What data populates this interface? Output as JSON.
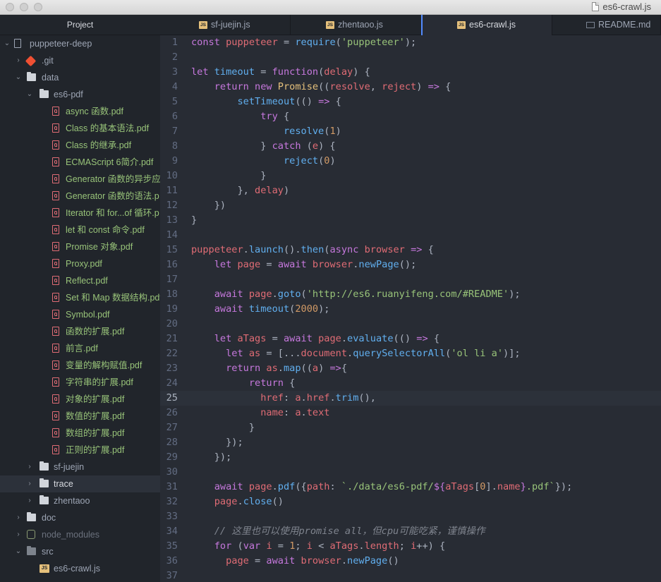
{
  "window": {
    "title": "es6-crawl.js"
  },
  "sidebar": {
    "header": "Project",
    "rows": [
      {
        "label": "puppeteer-deep",
        "depth": 0,
        "chev": "⌄",
        "icon": "repo",
        "kind": "dir"
      },
      {
        "label": ".git",
        "depth": 1,
        "chev": "›",
        "icon": "git",
        "kind": "dir"
      },
      {
        "label": "data",
        "depth": 1,
        "chev": "⌄",
        "icon": "folder",
        "kind": "dir"
      },
      {
        "label": "es6-pdf",
        "depth": 2,
        "chev": "⌄",
        "icon": "folder",
        "kind": "dir"
      },
      {
        "label": "async 函数.pdf",
        "depth": 3,
        "icon": "pdf",
        "kind": "pdf"
      },
      {
        "label": "Class 的基本语法.pdf",
        "depth": 3,
        "icon": "pdf",
        "kind": "pdf"
      },
      {
        "label": "Class 的继承.pdf",
        "depth": 3,
        "icon": "pdf",
        "kind": "pdf"
      },
      {
        "label": "ECMAScript 6简介.pdf",
        "depth": 3,
        "icon": "pdf",
        "kind": "pdf"
      },
      {
        "label": "Generator 函数的异步应",
        "depth": 3,
        "icon": "pdf",
        "kind": "pdf"
      },
      {
        "label": "Generator 函数的语法.p",
        "depth": 3,
        "icon": "pdf",
        "kind": "pdf"
      },
      {
        "label": "Iterator 和 for...of 循环.p",
        "depth": 3,
        "icon": "pdf",
        "kind": "pdf"
      },
      {
        "label": "let 和 const 命令.pdf",
        "depth": 3,
        "icon": "pdf",
        "kind": "pdf"
      },
      {
        "label": "Promise 对象.pdf",
        "depth": 3,
        "icon": "pdf",
        "kind": "pdf"
      },
      {
        "label": "Proxy.pdf",
        "depth": 3,
        "icon": "pdf",
        "kind": "pdf"
      },
      {
        "label": "Reflect.pdf",
        "depth": 3,
        "icon": "pdf",
        "kind": "pdf"
      },
      {
        "label": "Set 和 Map 数据结构.pdf",
        "depth": 3,
        "icon": "pdf",
        "kind": "pdf"
      },
      {
        "label": "Symbol.pdf",
        "depth": 3,
        "icon": "pdf",
        "kind": "pdf"
      },
      {
        "label": "函数的扩展.pdf",
        "depth": 3,
        "icon": "pdf",
        "kind": "pdf"
      },
      {
        "label": "前言.pdf",
        "depth": 3,
        "icon": "pdf",
        "kind": "pdf"
      },
      {
        "label": "变量的解构赋值.pdf",
        "depth": 3,
        "icon": "pdf",
        "kind": "pdf"
      },
      {
        "label": "字符串的扩展.pdf",
        "depth": 3,
        "icon": "pdf",
        "kind": "pdf"
      },
      {
        "label": "对象的扩展.pdf",
        "depth": 3,
        "icon": "pdf",
        "kind": "pdf"
      },
      {
        "label": "数值的扩展.pdf",
        "depth": 3,
        "icon": "pdf",
        "kind": "pdf"
      },
      {
        "label": "数组的扩展.pdf",
        "depth": 3,
        "icon": "pdf",
        "kind": "pdf"
      },
      {
        "label": "正则的扩展.pdf",
        "depth": 3,
        "icon": "pdf",
        "kind": "pdf"
      },
      {
        "label": "sf-juejin",
        "depth": 2,
        "chev": "›",
        "icon": "folder",
        "kind": "dir"
      },
      {
        "label": "trace",
        "depth": 2,
        "chev": "›",
        "icon": "folder",
        "kind": "dir",
        "selected": true
      },
      {
        "label": "zhentaoo",
        "depth": 2,
        "chev": "›",
        "icon": "folder",
        "kind": "dir"
      },
      {
        "label": "doc",
        "depth": 1,
        "chev": "›",
        "icon": "folder",
        "kind": "dir"
      },
      {
        "label": "node_modules",
        "depth": 1,
        "chev": "›",
        "icon": "node",
        "kind": "dim"
      },
      {
        "label": "src",
        "depth": 1,
        "chev": "⌄",
        "icon": "folder-dim",
        "kind": "dir"
      },
      {
        "label": "es6-crawl.js",
        "depth": 2,
        "icon": "js",
        "kind": "file"
      }
    ]
  },
  "tabs": [
    {
      "label": "sf-juejin.js",
      "icon": "JS",
      "active": false
    },
    {
      "label": "zhentaoo.js",
      "icon": "JS",
      "active": false
    },
    {
      "label": "es6-crawl.js",
      "icon": "JS",
      "active": true
    },
    {
      "label": "README.md",
      "icon": "MD",
      "active": false
    }
  ],
  "icons": {
    "repo": "book-icon",
    "git": "git-icon",
    "folder": "folder-icon",
    "folder-dim": "folder-icon",
    "pdf": "pdf-file-icon",
    "node": "nodejs-icon",
    "js": "js-file-icon"
  },
  "editor": {
    "cursor_line": 25,
    "lines": [
      [
        [
          "k",
          "const"
        ],
        [
          "",
          " "
        ],
        [
          "p",
          "puppeteer"
        ],
        [
          "",
          " = "
        ],
        [
          "f",
          "require"
        ],
        [
          "",
          "("
        ],
        [
          "s",
          "'puppeteer'"
        ],
        [
          "",
          ");"
        ]
      ],
      [],
      [
        [
          "k",
          "let"
        ],
        [
          "",
          " "
        ],
        [
          "f",
          "timeout"
        ],
        [
          "",
          " = "
        ],
        [
          "k",
          "function"
        ],
        [
          "",
          "("
        ],
        [
          "p",
          "delay"
        ],
        [
          "",
          ") {"
        ]
      ],
      [
        [
          "",
          "    "
        ],
        [
          "k",
          "return"
        ],
        [
          "",
          " "
        ],
        [
          "k",
          "new"
        ],
        [
          "",
          " "
        ],
        [
          "t",
          "Promise"
        ],
        [
          "",
          "(("
        ],
        [
          "p",
          "resolve"
        ],
        [
          "",
          ", "
        ],
        [
          "p",
          "reject"
        ],
        [
          "",
          ") "
        ],
        [
          "k",
          "=>"
        ],
        [
          "",
          " {"
        ]
      ],
      [
        [
          "",
          "        "
        ],
        [
          "f",
          "setTimeout"
        ],
        [
          "",
          "(() "
        ],
        [
          "k",
          "=>"
        ],
        [
          "",
          " {"
        ]
      ],
      [
        [
          "",
          "            "
        ],
        [
          "k",
          "try"
        ],
        [
          "",
          " {"
        ]
      ],
      [
        [
          "",
          "                "
        ],
        [
          "f",
          "resolve"
        ],
        [
          "",
          "("
        ],
        [
          "n",
          "1"
        ],
        [
          "",
          ")"
        ]
      ],
      [
        [
          "",
          "            } "
        ],
        [
          "k",
          "catch"
        ],
        [
          "",
          " ("
        ],
        [
          "p",
          "e"
        ],
        [
          "",
          ") {"
        ]
      ],
      [
        [
          "",
          "                "
        ],
        [
          "f",
          "reject"
        ],
        [
          "",
          "("
        ],
        [
          "n",
          "0"
        ],
        [
          "",
          ")"
        ]
      ],
      [
        [
          "",
          "            }"
        ]
      ],
      [
        [
          "",
          "        }, "
        ],
        [
          "p",
          "delay"
        ],
        [
          "",
          ")"
        ]
      ],
      [
        [
          "",
          "    })"
        ]
      ],
      [
        [
          "",
          "}"
        ]
      ],
      [],
      [
        [
          "p",
          "puppeteer"
        ],
        [
          "",
          "."
        ],
        [
          "f",
          "launch"
        ],
        [
          "",
          "()."
        ],
        [
          "f",
          "then"
        ],
        [
          "",
          "("
        ],
        [
          "k",
          "async"
        ],
        [
          "",
          " "
        ],
        [
          "p",
          "browser"
        ],
        [
          "",
          " "
        ],
        [
          "k",
          "=>"
        ],
        [
          "",
          " {"
        ]
      ],
      [
        [
          "",
          "    "
        ],
        [
          "k",
          "let"
        ],
        [
          "",
          " "
        ],
        [
          "p",
          "page"
        ],
        [
          "",
          " = "
        ],
        [
          "k",
          "await"
        ],
        [
          "",
          " "
        ],
        [
          "p",
          "browser"
        ],
        [
          "",
          "."
        ],
        [
          "f",
          "newPage"
        ],
        [
          "",
          "();"
        ]
      ],
      [],
      [
        [
          "",
          "    "
        ],
        [
          "k",
          "await"
        ],
        [
          "",
          " "
        ],
        [
          "p",
          "page"
        ],
        [
          "",
          "."
        ],
        [
          "f",
          "goto"
        ],
        [
          "",
          "("
        ],
        [
          "s",
          "'http://es6.ruanyifeng.com/#README'"
        ],
        [
          "",
          ");"
        ]
      ],
      [
        [
          "",
          "    "
        ],
        [
          "k",
          "await"
        ],
        [
          "",
          " "
        ],
        [
          "f",
          "timeout"
        ],
        [
          "",
          "("
        ],
        [
          "n",
          "2000"
        ],
        [
          "",
          ");"
        ]
      ],
      [],
      [
        [
          "",
          "    "
        ],
        [
          "k",
          "let"
        ],
        [
          "",
          " "
        ],
        [
          "p",
          "aTags"
        ],
        [
          "",
          " = "
        ],
        [
          "k",
          "await"
        ],
        [
          "",
          " "
        ],
        [
          "p",
          "page"
        ],
        [
          "",
          "."
        ],
        [
          "f",
          "evaluate"
        ],
        [
          "",
          "(() "
        ],
        [
          "k",
          "=>"
        ],
        [
          "",
          " {"
        ]
      ],
      [
        [
          "",
          "      "
        ],
        [
          "k",
          "let"
        ],
        [
          "",
          " "
        ],
        [
          "p",
          "as"
        ],
        [
          "",
          " = [..."
        ],
        [
          "p",
          "document"
        ],
        [
          "",
          "."
        ],
        [
          "f",
          "querySelectorAll"
        ],
        [
          "",
          "("
        ],
        [
          "s",
          "'ol li a'"
        ],
        [
          "",
          ")];"
        ]
      ],
      [
        [
          "",
          "      "
        ],
        [
          "k",
          "return"
        ],
        [
          "",
          " "
        ],
        [
          "p",
          "as"
        ],
        [
          "",
          "."
        ],
        [
          "f",
          "map"
        ],
        [
          "",
          "(("
        ],
        [
          "p",
          "a"
        ],
        [
          "",
          ") "
        ],
        [
          "k",
          "=>"
        ],
        [
          "",
          "{"
        ]
      ],
      [
        [
          "",
          "          "
        ],
        [
          "k",
          "return"
        ],
        [
          "",
          " {"
        ]
      ],
      [
        [
          "",
          "            "
        ],
        [
          "p",
          "href"
        ],
        [
          "",
          ": "
        ],
        [
          "p",
          "a"
        ],
        [
          "",
          "."
        ],
        [
          "p",
          "href"
        ],
        [
          "",
          "."
        ],
        [
          "f",
          "trim"
        ],
        [
          "",
          "(),"
        ]
      ],
      [
        [
          "",
          "            "
        ],
        [
          "p",
          "name"
        ],
        [
          "",
          ": "
        ],
        [
          "p",
          "a"
        ],
        [
          "",
          "."
        ],
        [
          "p",
          "text"
        ]
      ],
      [
        [
          "",
          "          }"
        ]
      ],
      [
        [
          "",
          "      });"
        ]
      ],
      [
        [
          "",
          "    });"
        ]
      ],
      [],
      [
        [
          "",
          "    "
        ],
        [
          "k",
          "await"
        ],
        [
          "",
          " "
        ],
        [
          "p",
          "page"
        ],
        [
          "",
          "."
        ],
        [
          "f",
          "pdf"
        ],
        [
          "",
          "({"
        ],
        [
          "p",
          "path"
        ],
        [
          "",
          ": "
        ],
        [
          "s",
          "`./data/es6-pdf/"
        ],
        [
          "k",
          "${"
        ],
        [
          "p",
          "aTags"
        ],
        [
          "",
          "["
        ],
        [
          "n",
          "0"
        ],
        [
          "",
          "]."
        ],
        [
          "p",
          "name"
        ],
        [
          "k",
          "}"
        ],
        [
          "s",
          ".pdf`"
        ],
        [
          "",
          "});"
        ]
      ],
      [
        [
          "",
          "    "
        ],
        [
          "p",
          "page"
        ],
        [
          "",
          "."
        ],
        [
          "f",
          "close"
        ],
        [
          "",
          "()"
        ]
      ],
      [],
      [
        [
          "",
          "    "
        ],
        [
          "c",
          "// 这里也可以使用promise all，但cpu可能吃紧，谨慎操作"
        ]
      ],
      [
        [
          "",
          "    "
        ],
        [
          "k",
          "for"
        ],
        [
          "",
          " ("
        ],
        [
          "k",
          "var"
        ],
        [
          "",
          " "
        ],
        [
          "p",
          "i"
        ],
        [
          "",
          " = "
        ],
        [
          "n",
          "1"
        ],
        [
          "",
          "; "
        ],
        [
          "p",
          "i"
        ],
        [
          "",
          " < "
        ],
        [
          "p",
          "aTags"
        ],
        [
          "",
          "."
        ],
        [
          "p",
          "length"
        ],
        [
          "",
          "; "
        ],
        [
          "p",
          "i"
        ],
        [
          "",
          "++) {"
        ]
      ],
      [
        [
          "",
          "      "
        ],
        [
          "p",
          "page"
        ],
        [
          "",
          " = "
        ],
        [
          "k",
          "await"
        ],
        [
          "",
          " "
        ],
        [
          "p",
          "browser"
        ],
        [
          "",
          "."
        ],
        [
          "f",
          "newPage"
        ],
        [
          "",
          "()"
        ]
      ],
      []
    ]
  }
}
